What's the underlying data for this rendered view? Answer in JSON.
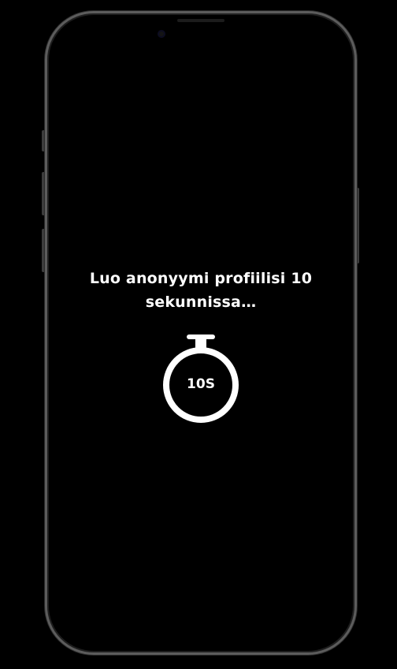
{
  "screen": {
    "message": "Luo anonyymi profiilisi 10 sekunnissa…",
    "timer": {
      "label": "10S",
      "icon": "stopwatch-icon"
    }
  },
  "colors": {
    "background": "#000000",
    "text": "#ffffff",
    "frame": "#5c5c5c"
  }
}
